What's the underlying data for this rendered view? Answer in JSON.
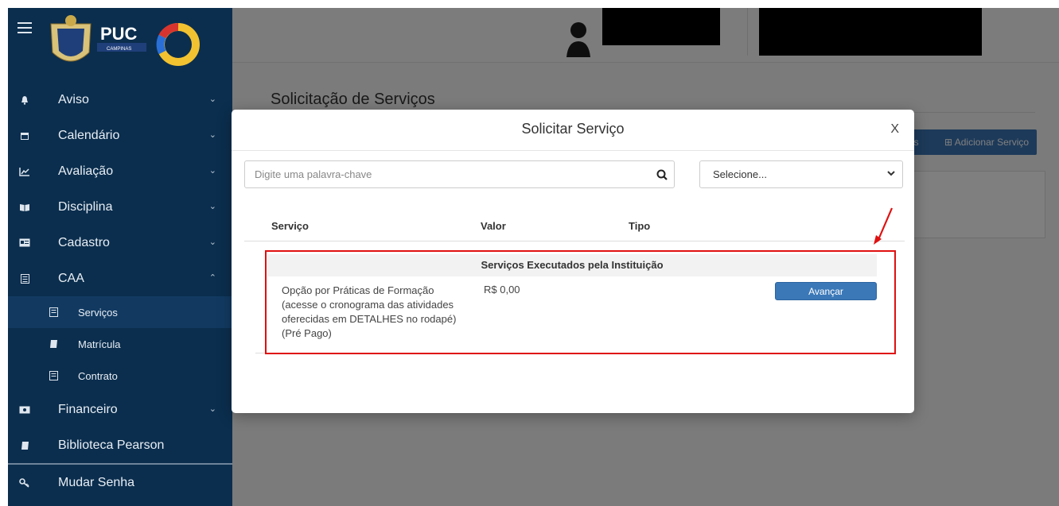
{
  "sidebar": {
    "items": [
      {
        "label": "Aviso",
        "icon": "bell-icon",
        "chevron": "⌄"
      },
      {
        "label": "Calendário",
        "icon": "calendar-icon",
        "chevron": "⌄"
      },
      {
        "label": "Avaliação",
        "icon": "chart-line-icon",
        "chevron": "⌄"
      },
      {
        "label": "Disciplina",
        "icon": "book-open-icon",
        "chevron": "⌄"
      },
      {
        "label": "Cadastro",
        "icon": "id-card-icon",
        "chevron": "⌄"
      },
      {
        "label": "CAA",
        "icon": "document-icon",
        "chevron": "⌃"
      }
    ],
    "subitems": [
      {
        "label": "Serviços",
        "icon": "document-icon"
      },
      {
        "label": "Matrícula",
        "icon": "book-icon"
      },
      {
        "label": "Contrato",
        "icon": "document-icon"
      }
    ],
    "items_after": [
      {
        "label": "Financeiro",
        "icon": "money-icon",
        "chevron": "⌄"
      },
      {
        "label": "Biblioteca Pearson",
        "icon": "book-icon"
      },
      {
        "label": "Mudar Senha",
        "icon": "key-icon"
      }
    ],
    "logo_text": "PUC",
    "logo_subtext": "CAMPINAS"
  },
  "page": {
    "title": "Solicitação de Serviços",
    "btn_partial": "os",
    "btn_add": "⊞ Adicionar Serviço"
  },
  "modal": {
    "title": "Solicitar Serviço",
    "close": "X",
    "search_placeholder": "Digite uma palavra-chave",
    "select_value": "Selecione...",
    "headers": {
      "service": "Serviço",
      "value": "Valor",
      "type": "Tipo"
    },
    "group": "Serviços Executados pela Instituição",
    "rows": [
      {
        "service": "Opção por Práticas de Formação (acesse o cronograma das atividades oferecidas em DETALHES no rodapé) (Pré Pago)",
        "value": "R$ 0,00",
        "type": "",
        "action": "Avançar"
      }
    ]
  },
  "colors": {
    "sidebar": "#0b2e4e",
    "accent": "#3a78b8",
    "highlight": "#e01010"
  }
}
